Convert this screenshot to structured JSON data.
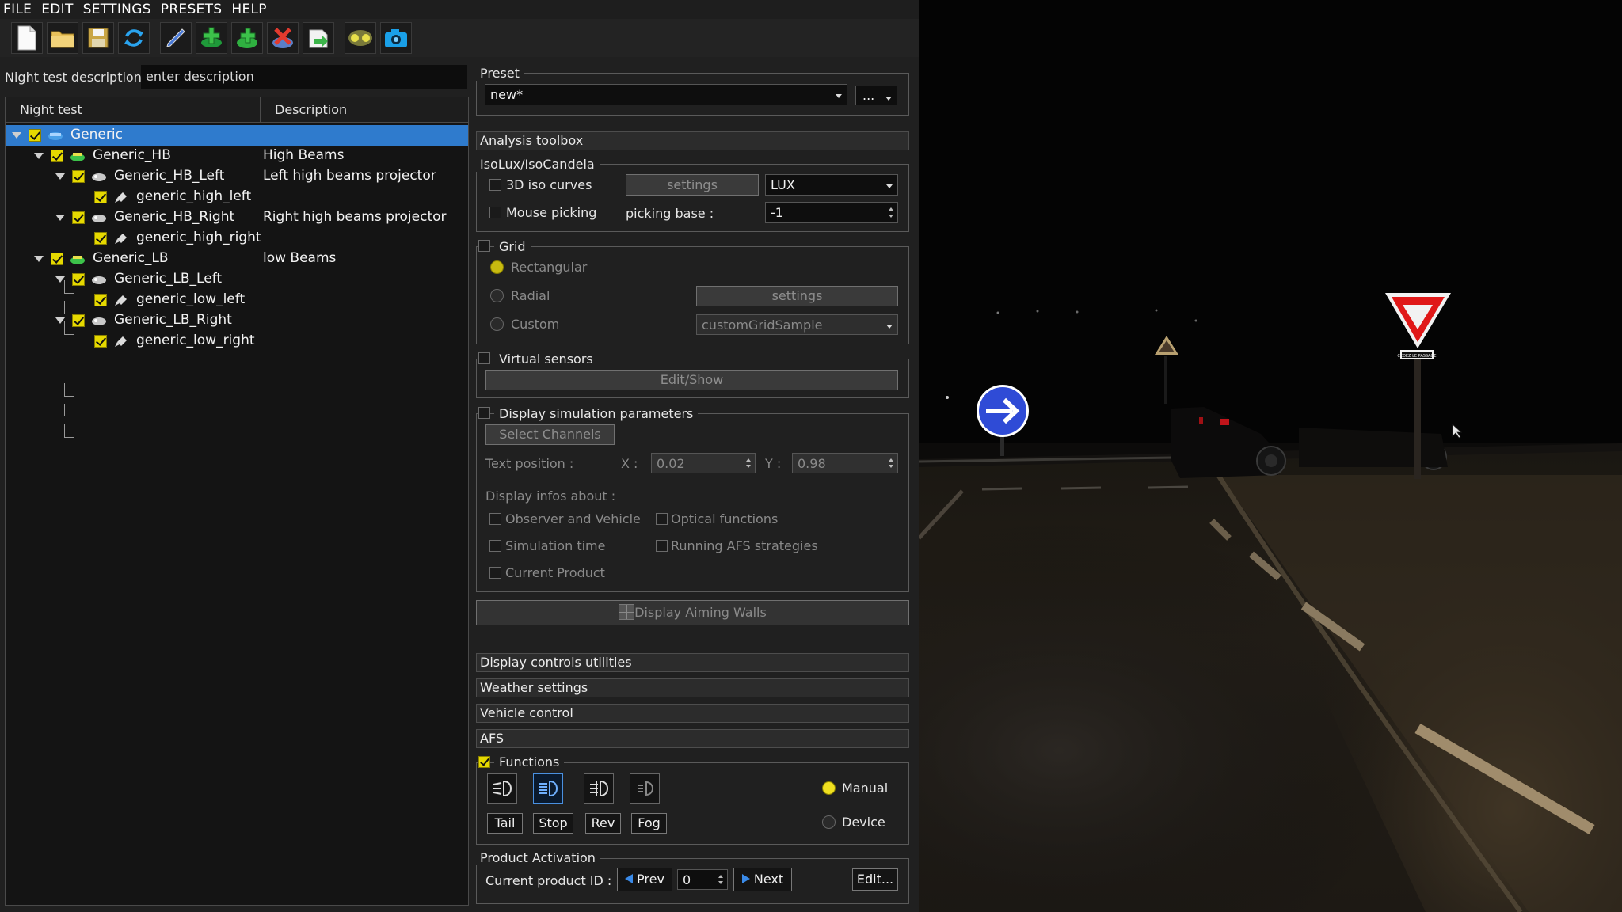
{
  "menu": {
    "items": [
      "FILE",
      "EDIT",
      "SETTINGS",
      "PRESETS",
      "HELP"
    ]
  },
  "toolbar": {
    "icons": [
      "new-file-icon",
      "open-folder-icon",
      "save-icon",
      "refresh-icon",
      "edit-pen-icon",
      "add-green-icon",
      "add-headlamp-icon",
      "delete-icon",
      "export-icon",
      "headlamp-icon",
      "camera-icon"
    ]
  },
  "left": {
    "desc_label": "Night test description",
    "desc_placeholder": "enter description",
    "col_night_test": "Night test",
    "col_description": "Description",
    "tree": [
      {
        "name": "Generic",
        "desc": ""
      },
      {
        "name": "Generic_HB",
        "desc": "High Beams"
      },
      {
        "name": "Generic_HB_Left",
        "desc": "Left high beams projector"
      },
      {
        "name": "generic_high_left",
        "desc": ""
      },
      {
        "name": "Generic_HB_Right",
        "desc": "Right high beams projector"
      },
      {
        "name": "generic_high_right",
        "desc": ""
      },
      {
        "name": "Generic_LB",
        "desc": "low Beams"
      },
      {
        "name": "Generic_LB_Left",
        "desc": ""
      },
      {
        "name": "generic_low_left",
        "desc": ""
      },
      {
        "name": "Generic_LB_Right",
        "desc": ""
      },
      {
        "name": "generic_low_right",
        "desc": ""
      }
    ]
  },
  "preset": {
    "title": "Preset",
    "value": "new*",
    "more": "..."
  },
  "analysis": {
    "header": "Analysis toolbox",
    "isolux_title": "IsoLux/IsoCandela",
    "iso_curves": "3D iso curves",
    "settings": "settings",
    "unit": "LUX",
    "mouse_picking": "Mouse picking",
    "picking_base_label": "picking base :",
    "picking_base": "-1",
    "grid_title": "Grid",
    "rectangular": "Rectangular",
    "radial": "Radial",
    "grid_settings": "settings",
    "custom": "Custom",
    "custom_value": "customGridSample",
    "virtual_sensors": "Virtual sensors",
    "edit_show": "Edit/Show",
    "display_sim": "Display simulation parameters",
    "select_channels": "Select Channels",
    "text_position": "Text position :",
    "x_label": "X :",
    "x_value": "0.02",
    "y_label": "Y :",
    "y_value": "0.98",
    "display_infos": "Display infos about :",
    "observer": "Observer and Vehicle",
    "optical": "Optical functions",
    "sim_time": "Simulation time",
    "afs_strat": "Running AFS strategies",
    "current_product": "Current Product",
    "aiming_walls": "Display Aiming Walls"
  },
  "sections": {
    "display_controls": "Display controls  utilities",
    "weather": "Weather settings",
    "vehicle": "Vehicle control",
    "afs": "AFS"
  },
  "afs": {
    "functions": "Functions",
    "manual": "Manual",
    "device": "Device",
    "buttons": [
      "Tail",
      "Stop",
      "Rev",
      "Fog"
    ]
  },
  "product": {
    "title": "Product Activation",
    "label": "Current product ID :",
    "prev": "Prev",
    "value": "0",
    "next": "Next",
    "edit": "Edit..."
  },
  "scene": {
    "sign_text": "CÉDEZ LE PASSAGE",
    "accent": "#2f7bcd",
    "check_yellow": "#e6d900"
  }
}
